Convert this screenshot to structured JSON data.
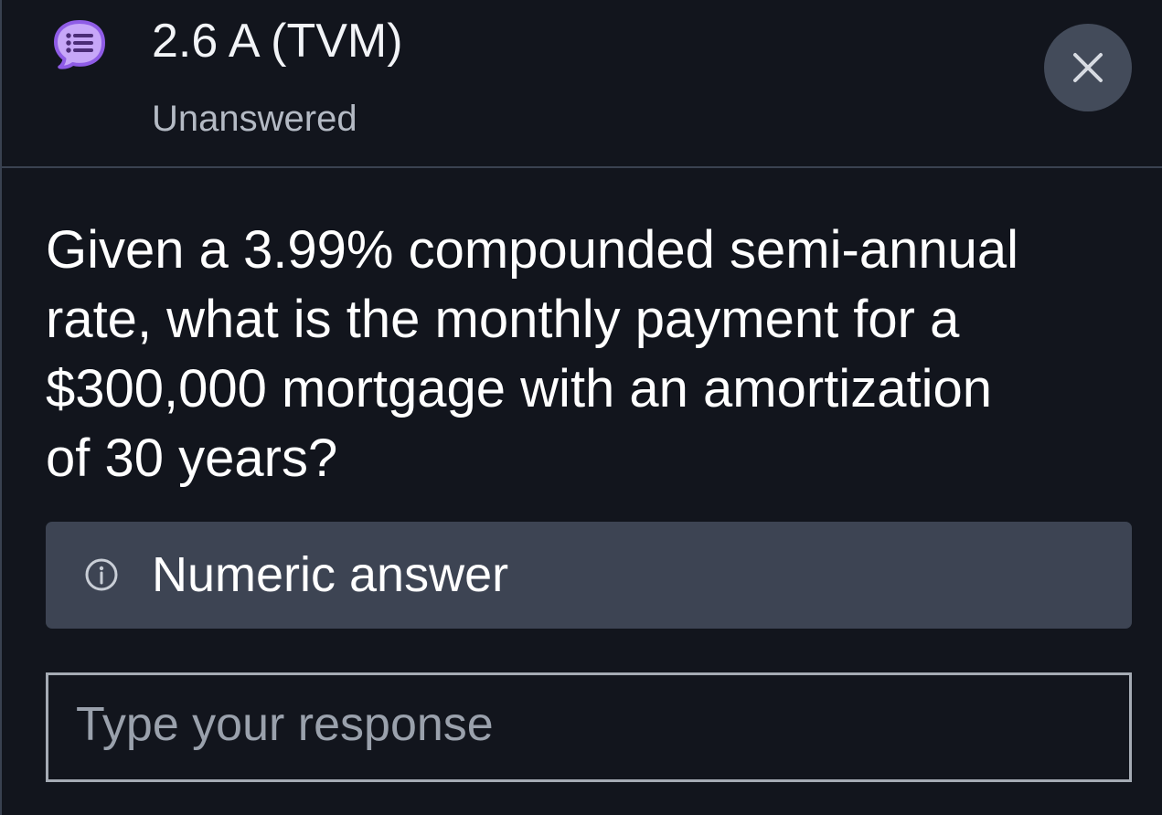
{
  "header": {
    "icon": "chat-list-icon",
    "title": "2.6 A (TVM)",
    "status": "Unanswered",
    "close_icon": "close-icon",
    "close_button_color": "#434b5a",
    "icon_color": "#b38af0"
  },
  "question": {
    "lines": [
      "Given a 3.99% compounded semi-annual",
      "rate, what is the monthly payment for a",
      "$300,000 mortgage with an amortization",
      "of 30 years?"
    ]
  },
  "answer": {
    "type_icon": "info-icon",
    "type_label": "Numeric answer",
    "banner_color": "#3d4453"
  },
  "response": {
    "placeholder": "Type your response",
    "value": ""
  }
}
